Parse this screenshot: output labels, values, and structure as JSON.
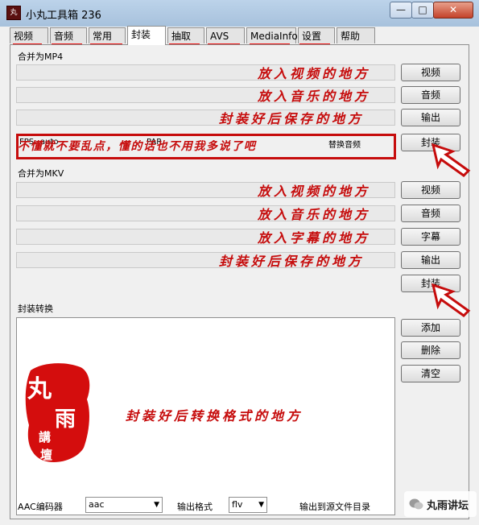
{
  "window": {
    "title": "小丸工具箱 236",
    "icon": "丸"
  },
  "titlebar_buttons": {
    "minimize": "—",
    "maximize": "□",
    "close": "✕"
  },
  "tabs": [
    "视频",
    "音频",
    "常用",
    "封装",
    "抽取",
    "AVS",
    "MediaInfo",
    "设置",
    "帮助"
  ],
  "active_tab": "封装",
  "mp4": {
    "group": "合并为MP4",
    "video_hint": "放入视频的地方",
    "audio_hint": "放入音乐的地方",
    "output_hint": "封装好后保存的地方",
    "fps_label": "FPS:",
    "fps_value": "auto",
    "par_label": "PAR",
    "replace_audio": "替换音频",
    "warning": "不懂就不要乱点，懂的话也不用我多说了吧",
    "btn_video": "视频",
    "btn_audio": "音频",
    "btn_output": "输出",
    "btn_mux": "封装"
  },
  "mkv": {
    "group": "合并为MKV",
    "video_hint": "放入视频的地方",
    "audio_hint": "放入音乐的地方",
    "subtitle_hint": "放入字幕的地方",
    "output_hint": "封装好后保存的地方",
    "btn_video": "视频",
    "btn_audio": "音频",
    "btn_subtitle": "字幕",
    "btn_output": "输出",
    "btn_mux": "封装"
  },
  "convert": {
    "group": "封装转换",
    "hint": "封装好后转换格式的地方",
    "btn_add": "添加",
    "btn_delete": "删除",
    "btn_clear": "清空",
    "seal_chars": [
      "丸",
      "雨",
      "講",
      "壇"
    ]
  },
  "bottom": {
    "aac_label": "AAC编码器",
    "aac_value": "aac",
    "format_label": "输出格式",
    "format_value": "flv",
    "output_to_source": "输出到源文件目录"
  },
  "watermark": "丸雨讲坛",
  "colors": {
    "annotation": "#c60c0c",
    "titlebar": "#a7c1dc"
  }
}
